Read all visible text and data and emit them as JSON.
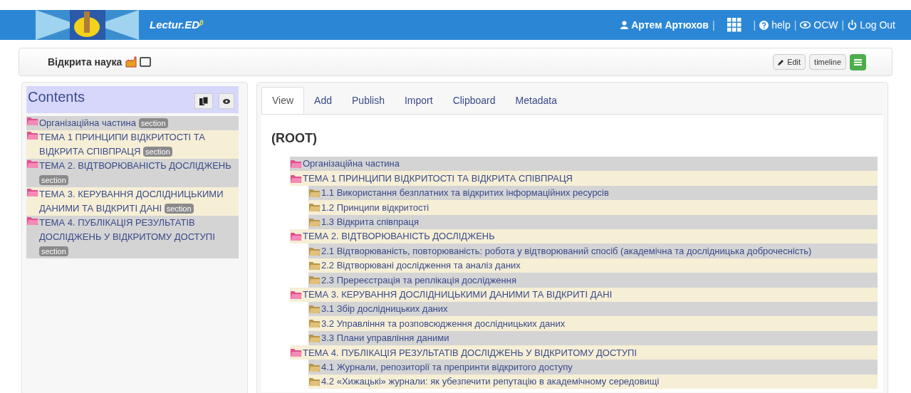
{
  "header": {
    "brand": "Lectur.ED",
    "brand_sup": "β",
    "nav": [
      {
        "kind": "user",
        "text": "Артем Артюхов"
      },
      {
        "kind": "separator",
        "text": "|"
      },
      {
        "kind": "apps"
      },
      {
        "kind": "separator",
        "text": "|"
      },
      {
        "kind": "help",
        "text": "help"
      },
      {
        "kind": "separator",
        "text": "|"
      },
      {
        "kind": "ocw",
        "text": "OCW"
      },
      {
        "kind": "separator",
        "text": "|"
      },
      {
        "kind": "logout",
        "text": "Log Out"
      }
    ]
  },
  "toolbar": {
    "title": "Відкрита наука",
    "buttons": [
      "Edit",
      "timeline"
    ]
  },
  "contents": {
    "title": "Contents",
    "items": [
      {
        "text": "Організаційна частина",
        "badge": "section"
      },
      {
        "text": "ТЕМА 1 ПРИНЦИПИ ВІДКРИТОСТІ ТА ВІДКРИТА СПІВПРАЦЯ",
        "badge": "section"
      },
      {
        "text": "ТЕМА 2. ВІДТВОРЮВАНІСТЬ ДОСЛІДЖЕНЬ",
        "badge": "section"
      },
      {
        "text": "ТЕМА 3. КЕРУВАННЯ ДОСЛІДНИЦЬКИМИ ДАНИМИ ТА ВІДКРИТІ ДАНІ",
        "badge": "section"
      },
      {
        "text": "ТЕМА 4. ПУБЛІКАЦІЯ РЕЗУЛЬТАТІВ ДОСЛІДЖЕНЬ У ВІДКРИТОМУ ДОСТУПІ",
        "badge": "section"
      }
    ]
  },
  "tabs": [
    {
      "label": "View",
      "selected": true
    },
    {
      "label": "Add",
      "selected": false
    },
    {
      "label": "Publish",
      "selected": false
    },
    {
      "label": "Import",
      "selected": false
    },
    {
      "label": "Clipboard",
      "selected": false
    },
    {
      "label": "Metadata",
      "selected": false
    }
  ],
  "root_title": "(ROOT)",
  "tree": [
    {
      "text": "Організаційна частина"
    },
    {
      "text": "ТЕМА 1 ПРИНЦИПИ ВІДКРИТОСТІ ТА ВІДКРИТА СПІВПРАЦЯ",
      "children": [
        {
          "text": "1.1 Використання безплатних та відкритих інформаційних ресурсів"
        },
        {
          "text": "1.2 Принципи відкритості"
        },
        {
          "text": "1.3 Відкрита співпраця"
        }
      ]
    },
    {
      "text": "ТЕМА 2. ВІДТВОРЮВАНІСТЬ ДОСЛІДЖЕНЬ",
      "children": [
        {
          "text": "2.1 Відтворюваність, повторюваність: робота у відтворюваний спосіб (академічна та дослідницька доброчесність)"
        },
        {
          "text": "2.2 Відтворювані дослідження та аналіз даних"
        },
        {
          "text": "2.3 Пререєстрація та реплікація дослідження"
        }
      ]
    },
    {
      "text": "ТЕМА 3. КЕРУВАННЯ ДОСЛІДНИЦЬКИМИ ДАНИМИ ТА ВІДКРИТІ ДАНІ",
      "children": [
        {
          "text": "3.1 Збір дослідницьких даних"
        },
        {
          "text": "3.2 Управління та розповсюдження дослідницьких даних"
        },
        {
          "text": "3.3 Плани управління даними"
        }
      ]
    },
    {
      "text": "ТЕМА 4. ПУБЛІКАЦІЯ РЕЗУЛЬТАТІВ ДОСЛІДЖЕНЬ У ВІДКРИТОМУ ДОСТУПІ",
      "children": [
        {
          "text": "4.1 Журнали, репозиторії та препринти відкритого доступу"
        },
        {
          "text": "4.2 «Хижацькі» журнали: як убезпечити репутацію в академічному середовищі"
        }
      ]
    }
  ]
}
